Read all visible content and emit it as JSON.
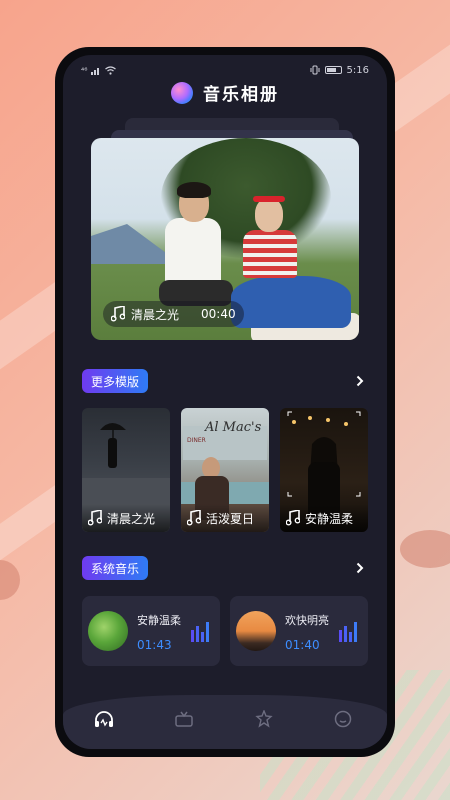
{
  "status_bar": {
    "signal_text": "⁴⁶",
    "time": "5:16"
  },
  "app": {
    "title": "音乐相册"
  },
  "hero": {
    "song": "清晨之光",
    "duration": "00:40"
  },
  "templates": {
    "badge": "更多模版",
    "items": [
      {
        "label": "清晨之光"
      },
      {
        "label": "活泼夏日"
      },
      {
        "label": "安静温柔"
      }
    ],
    "thumb_texts": [
      "Al Mac's",
      "DINER"
    ]
  },
  "system_music": {
    "badge": "系统音乐",
    "items": [
      {
        "name": "安静温柔",
        "duration": "01:43"
      },
      {
        "name": "欢快明亮",
        "duration": "01:40"
      }
    ]
  },
  "colors": {
    "accent": "#3d8dff",
    "badge_start": "#6f3bf0",
    "badge_end": "#2f7bf5",
    "background": "#1d1d2b"
  },
  "nav": {
    "icons": [
      "headphones-icon",
      "tv-icon",
      "star-hand-icon",
      "smile-icon"
    ]
  }
}
